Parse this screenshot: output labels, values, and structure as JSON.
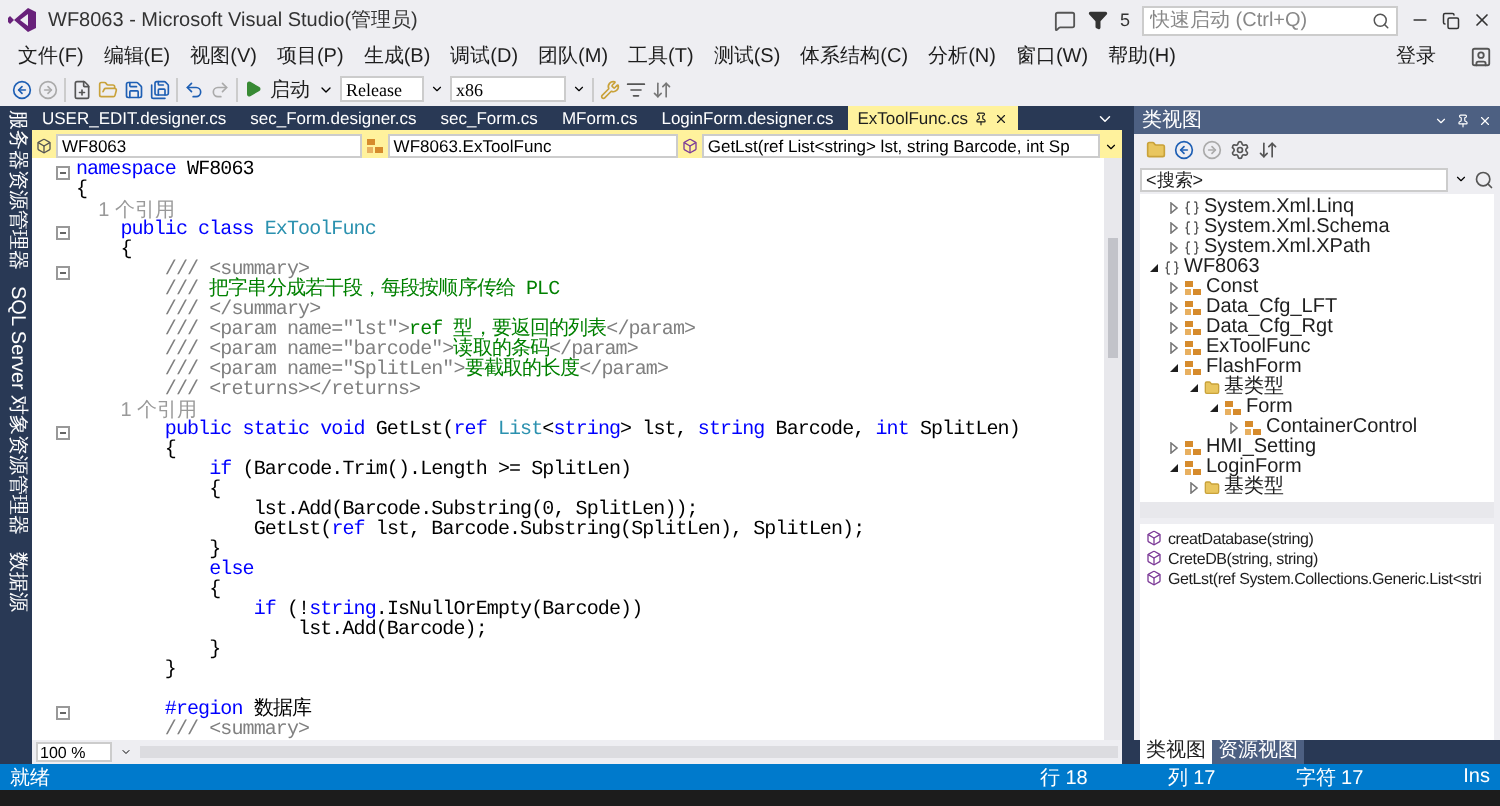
{
  "window": {
    "title": "WF8063 - Microsoft Visual Studio(管理员)",
    "notification_count": "5",
    "quick_launch": {
      "placeholder": "快速启动 (Ctrl+Q)"
    }
  },
  "menu": [
    "文件(F)",
    "编辑(E)",
    "视图(V)",
    "项目(P)",
    "生成(B)",
    "调试(D)",
    "团队(M)",
    "工具(T)",
    "测试(S)",
    "体系结构(C)",
    "分析(N)",
    "窗口(W)",
    "帮助(H)"
  ],
  "sign_in": "登录",
  "toolbar": {
    "start": "启动",
    "configuration": "Release",
    "platform": "x86"
  },
  "side_tabs": [
    "服务器资源管理器",
    "SQL Server 对象资源管理器",
    "数据源"
  ],
  "doc_tabs": [
    {
      "label": "USER_EDIT.designer.cs",
      "selected": false
    },
    {
      "label": "sec_Form.designer.cs",
      "selected": false
    },
    {
      "label": "sec_Form.cs",
      "selected": false
    },
    {
      "label": "MForm.cs",
      "selected": false
    },
    {
      "label": "LoginForm.designer.cs",
      "selected": false
    },
    {
      "label": "ExToolFunc.cs",
      "selected": true
    }
  ],
  "nav_bar": {
    "project": "WF8063",
    "type": "WF8063.ExToolFunc",
    "member": "GetLst(ref List<string> lst, string Barcode, int Sp"
  },
  "code": {
    "lines": [
      {
        "kind": "code",
        "collapsible": true,
        "segments": [
          {
            "text": "namespace",
            "kind": "keyword"
          },
          {
            "text": " WF8063",
            "kind": "plain"
          }
        ]
      },
      {
        "kind": "code",
        "collapsible": false,
        "segments": [
          {
            "text": "{",
            "kind": "plain"
          }
        ]
      },
      {
        "kind": "lens",
        "collapsible": false,
        "text": "    1 个引用"
      },
      {
        "kind": "code",
        "collapsible": true,
        "segments": [
          {
            "text": "    public class",
            "kind": "keyword"
          },
          {
            "text": " ExToolFunc",
            "kind": "type"
          }
        ]
      },
      {
        "kind": "code",
        "collapsible": false,
        "segments": [
          {
            "text": "    {",
            "kind": "plain"
          }
        ]
      },
      {
        "kind": "code",
        "collapsible": true,
        "segments": [
          {
            "text": "        /// <summary>",
            "kind": "doc"
          }
        ]
      },
      {
        "kind": "code",
        "collapsible": false,
        "segments": [
          {
            "text": "        ///",
            "kind": "doc"
          },
          {
            "text": " 把字串分成若干段，每段按顺序传给 PLC",
            "kind": "comment"
          }
        ]
      },
      {
        "kind": "code",
        "collapsible": false,
        "segments": [
          {
            "text": "        /// </summary>",
            "kind": "doc"
          }
        ]
      },
      {
        "kind": "code",
        "collapsible": false,
        "segments": [
          {
            "text": "        /// <param name=\"lst\">",
            "kind": "doc"
          },
          {
            "text": "ref 型，要返回的列表",
            "kind": "comment"
          },
          {
            "text": "</param>",
            "kind": "doc"
          }
        ]
      },
      {
        "kind": "code",
        "collapsible": false,
        "segments": [
          {
            "text": "        /// <param name=\"barcode\">",
            "kind": "doc"
          },
          {
            "text": "读取的条码",
            "kind": "comment"
          },
          {
            "text": "</param>",
            "kind": "doc"
          }
        ]
      },
      {
        "kind": "code",
        "collapsible": false,
        "segments": [
          {
            "text": "        /// <param name=\"SplitLen\">",
            "kind": "doc"
          },
          {
            "text": "要截取的长度",
            "kind": "comment"
          },
          {
            "text": "</param>",
            "kind": "doc"
          }
        ]
      },
      {
        "kind": "code",
        "collapsible": false,
        "segments": [
          {
            "text": "        /// <returns></returns>",
            "kind": "doc"
          }
        ]
      },
      {
        "kind": "lens",
        "collapsible": false,
        "text": "        1 个引用"
      },
      {
        "kind": "code",
        "collapsible": true,
        "segments": [
          {
            "text": "        public static void",
            "kind": "keyword"
          },
          {
            "text": " GetLst(",
            "kind": "plain"
          },
          {
            "text": "ref",
            "kind": "keyword"
          },
          {
            "text": " List",
            "kind": "type"
          },
          {
            "text": "<",
            "kind": "plain"
          },
          {
            "text": "string",
            "kind": "keyword"
          },
          {
            "text": "> lst, ",
            "kind": "plain"
          },
          {
            "text": "string",
            "kind": "keyword"
          },
          {
            "text": " Barcode, ",
            "kind": "plain"
          },
          {
            "text": "int",
            "kind": "keyword"
          },
          {
            "text": " SplitLen)",
            "kind": "plain"
          }
        ]
      },
      {
        "kind": "code",
        "collapsible": false,
        "segments": [
          {
            "text": "        {",
            "kind": "plain"
          }
        ]
      },
      {
        "kind": "code",
        "collapsible": false,
        "segments": [
          {
            "text": "            if",
            "kind": "keyword"
          },
          {
            "text": " (Barcode.Trim().Length >= SplitLen)",
            "kind": "plain"
          }
        ]
      },
      {
        "kind": "code",
        "collapsible": false,
        "segments": [
          {
            "text": "            {",
            "kind": "plain"
          }
        ]
      },
      {
        "kind": "code",
        "collapsible": false,
        "segments": [
          {
            "text": "                lst.Add(Barcode.Substring(0, SplitLen));",
            "kind": "plain"
          }
        ]
      },
      {
        "kind": "code",
        "collapsible": false,
        "segments": [
          {
            "text": "                GetLst(",
            "kind": "plain"
          },
          {
            "text": "ref",
            "kind": "keyword"
          },
          {
            "text": " lst, Barcode.Substring(SplitLen), SplitLen);",
            "kind": "plain"
          }
        ]
      },
      {
        "kind": "code",
        "collapsible": false,
        "segments": [
          {
            "text": "            }",
            "kind": "plain"
          }
        ]
      },
      {
        "kind": "code",
        "collapsible": false,
        "segments": [
          {
            "text": "            else",
            "kind": "keyword"
          }
        ]
      },
      {
        "kind": "code",
        "collapsible": false,
        "segments": [
          {
            "text": "            {",
            "kind": "plain"
          }
        ]
      },
      {
        "kind": "code",
        "collapsible": false,
        "segments": [
          {
            "text": "                if",
            "kind": "keyword"
          },
          {
            "text": " (!",
            "kind": "plain"
          },
          {
            "text": "string",
            "kind": "keyword"
          },
          {
            "text": ".IsNullOrEmpty(Barcode))",
            "kind": "plain"
          }
        ]
      },
      {
        "kind": "code",
        "collapsible": false,
        "segments": [
          {
            "text": "                    lst.Add(Barcode);",
            "kind": "plain"
          }
        ]
      },
      {
        "kind": "code",
        "collapsible": false,
        "segments": [
          {
            "text": "            }",
            "kind": "plain"
          }
        ]
      },
      {
        "kind": "code",
        "collapsible": false,
        "segments": [
          {
            "text": "        }",
            "kind": "plain"
          }
        ]
      },
      {
        "kind": "blank",
        "collapsible": false
      },
      {
        "kind": "code",
        "collapsible": true,
        "segments": [
          {
            "text": "        #region",
            "kind": "keyword"
          },
          {
            "text": " 数据库",
            "kind": "plain"
          }
        ]
      },
      {
        "kind": "code",
        "collapsible": false,
        "segments": [
          {
            "text": "        /// <summary>",
            "kind": "doc"
          }
        ]
      }
    ]
  },
  "zoom": "100 %",
  "class_view": {
    "title": "类视图",
    "search": {
      "placeholder": "<搜索>"
    },
    "tree_scrolled_parent_children": [
      {
        "label": "System.Xml.Linq",
        "kind": "namespace",
        "expanded": false
      },
      {
        "label": "System.Xml.Schema",
        "kind": "namespace",
        "expanded": false
      },
      {
        "label": "System.Xml.XPath",
        "kind": "namespace",
        "expanded": false
      }
    ],
    "tree": [
      {
        "label": "WF8063",
        "kind": "namespace",
        "expanded": true,
        "children": [
          {
            "label": "Const",
            "kind": "class",
            "expanded": false
          },
          {
            "label": "Data_Cfg_LFT",
            "kind": "class",
            "expanded": false
          },
          {
            "label": "Data_Cfg_Rgt",
            "kind": "class",
            "expanded": false
          },
          {
            "label": "ExToolFunc",
            "kind": "class",
            "expanded": false
          },
          {
            "label": "FlashForm",
            "kind": "class",
            "expanded": true,
            "children": [
              {
                "label": "基类型",
                "kind": "folder",
                "expanded": true,
                "children": [
                  {
                    "label": "Form",
                    "kind": "class",
                    "expanded": true,
                    "children": [
                      {
                        "label": "ContainerControl",
                        "kind": "class",
                        "expanded": false
                      }
                    ]
                  }
                ]
              }
            ]
          },
          {
            "label": "HMI_Setting",
            "kind": "class",
            "expanded": false
          },
          {
            "label": "LoginForm",
            "kind": "class",
            "expanded": true,
            "children": [
              {
                "label": "基类型",
                "kind": "folder",
                "expanded": false
              }
            ]
          }
        ]
      }
    ],
    "members": [
      "creatDatabase(string)",
      "CreteDB(string, string)",
      "GetLst(ref System.Collections.Generic.List<stri"
    ],
    "tabs": [
      {
        "label": "类视图",
        "selected": true
      },
      {
        "label": "资源视图",
        "selected": false
      }
    ]
  },
  "status_bar": {
    "message": "就绪",
    "line": "行 18",
    "column": "列 17",
    "char": "字符 17",
    "mode": "Ins"
  }
}
